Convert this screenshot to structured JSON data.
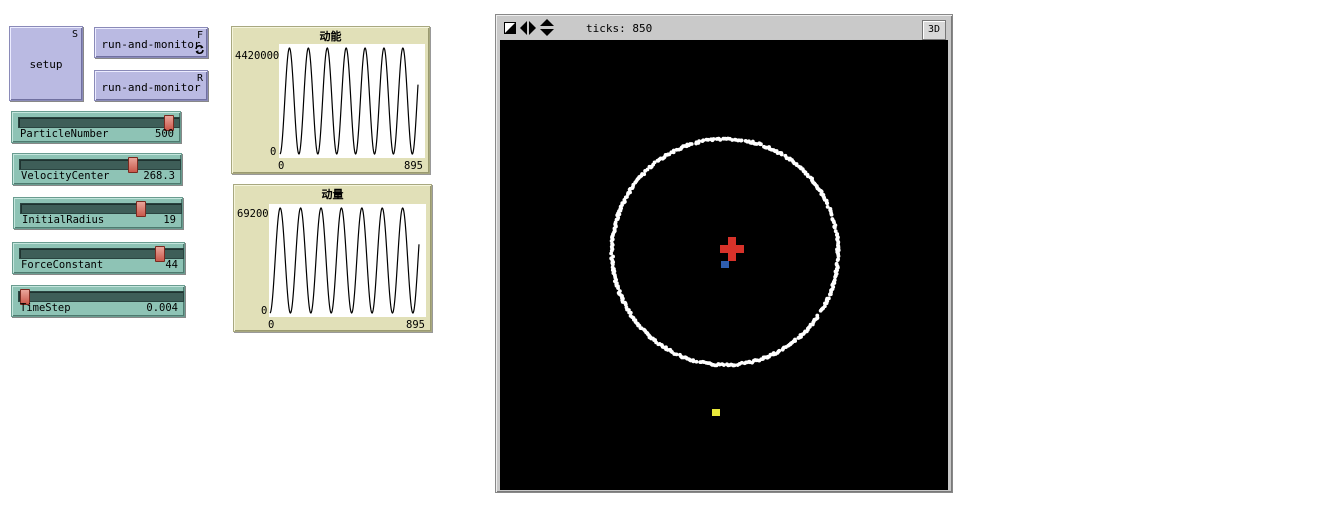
{
  "buttons": {
    "setup": {
      "label": "setup",
      "key": "S"
    },
    "run_forever": {
      "label": "run-and-monitor",
      "key": "F"
    },
    "run_once": {
      "label": "run-and-monitor",
      "key": "R"
    }
  },
  "sliders": [
    {
      "name": "ParticleNumber",
      "value": "500",
      "fraction": 0.96
    },
    {
      "name": "VelocityCenter",
      "value": "268.3",
      "fraction": 0.72
    },
    {
      "name": "InitialRadius",
      "value": "19",
      "fraction": 0.76
    },
    {
      "name": "ForceConstant",
      "value": "44",
      "fraction": 0.88
    },
    {
      "name": "TimeStep",
      "value": "0.004",
      "fraction": 0.01
    }
  ],
  "plots": [
    {
      "title": "动能",
      "ymax": "4420000",
      "ymin": "0",
      "xmin": "0",
      "xmax": "895"
    },
    {
      "title": "动量",
      "ymax": "69200",
      "ymin": "0",
      "xmin": "0",
      "xmax": "895"
    }
  ],
  "view": {
    "ticks_label": "ticks: 850",
    "btn_3d": "3D",
    "colors": {
      "background": "#000000",
      "particles": "#ffffff",
      "center": "#d7322a",
      "blue_patch": "#2f5dae",
      "yellow_patch": "#e8e83a"
    }
  },
  "chart_data": [
    {
      "type": "line",
      "title": "动能",
      "xlim": [
        0,
        895
      ],
      "ylim": [
        0,
        4420000
      ],
      "periods": 7.3,
      "series": [
        {
          "values_note_free": true
        }
      ]
    },
    {
      "type": "line",
      "title": "动量",
      "xlim": [
        0,
        895
      ],
      "ylim": [
        0,
        69200
      ],
      "periods": 7.3,
      "series": [
        {}
      ]
    }
  ]
}
